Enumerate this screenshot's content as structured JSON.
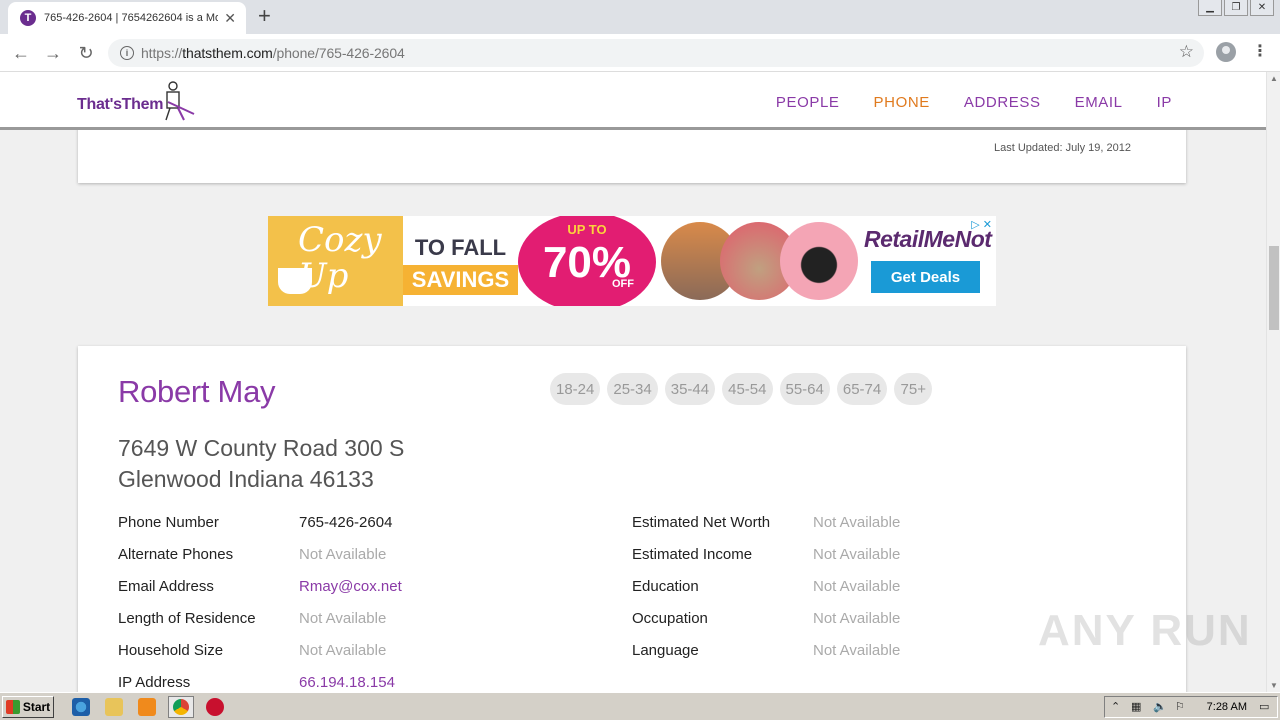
{
  "browser": {
    "tab_title": "765-426-2604 | 7654262604 is a Mo",
    "tab_favicon_letter": "T",
    "url_prefix": "https://",
    "url_host": "thatsthem.com",
    "url_path": "/phone/765-426-2604"
  },
  "site": {
    "logo_text": "That'sThem",
    "nav": [
      {
        "label": "PEOPLE",
        "active": false
      },
      {
        "label": "PHONE",
        "active": true
      },
      {
        "label": "ADDRESS",
        "active": false
      },
      {
        "label": "EMAIL",
        "active": false
      },
      {
        "label": "IP",
        "active": false
      }
    ],
    "accent_color": "#8a3aa7",
    "active_color": "#e07a1e"
  },
  "previous_card": {
    "last_updated": "Last Updated: July 19, 2012"
  },
  "ad": {
    "cozy": "Cozy",
    "up": "Up",
    "to_fall": "TO FALL",
    "savings": "SAVINGS",
    "up_to": "UP TO",
    "percent": "70%",
    "off": "OFF",
    "brand": "RetailMeNot",
    "cta": "Get Deals"
  },
  "person": {
    "name": "Robert May",
    "age_ranges": [
      "18-24",
      "25-34",
      "35-44",
      "45-54",
      "55-64",
      "65-74",
      "75+"
    ],
    "address_line1": "7649 W County Road 300 S",
    "address_line2": "Glenwood Indiana 46133",
    "details_left": [
      {
        "label": "Phone Number",
        "value": "765-426-2604",
        "kind": "plain"
      },
      {
        "label": "Alternate Phones",
        "value": "Not Available",
        "kind": "na"
      },
      {
        "label": "Email Address",
        "value": "Rmay@cox.net",
        "kind": "link"
      },
      {
        "label": "Length of Residence",
        "value": "Not Available",
        "kind": "na"
      },
      {
        "label": "Household Size",
        "value": "Not Available",
        "kind": "na"
      },
      {
        "label": "IP Address",
        "value": "66.194.18.154",
        "kind": "link"
      }
    ],
    "details_right": [
      {
        "label": "Estimated Net Worth",
        "value": "Not Available",
        "kind": "na"
      },
      {
        "label": "Estimated Income",
        "value": "Not Available",
        "kind": "na"
      },
      {
        "label": "Education",
        "value": "Not Available",
        "kind": "na"
      },
      {
        "label": "Occupation",
        "value": "Not Available",
        "kind": "na"
      },
      {
        "label": "Language",
        "value": "Not Available",
        "kind": "na"
      }
    ]
  },
  "watermark": "ANY RUN",
  "taskbar": {
    "start_label": "Start",
    "clock": "7:28 AM"
  }
}
